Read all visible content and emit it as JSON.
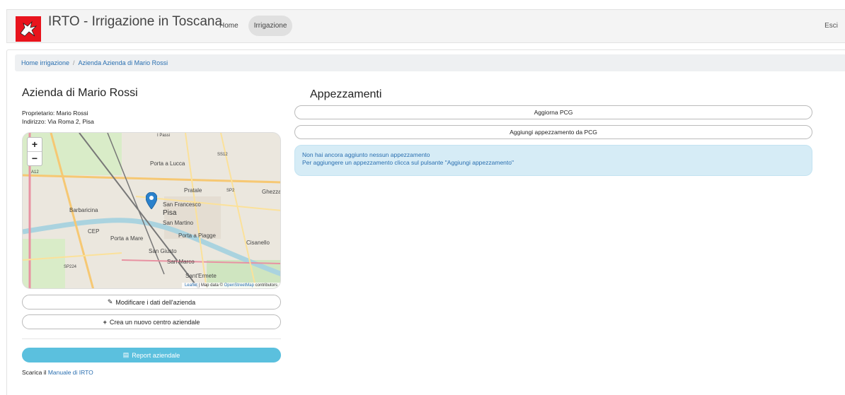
{
  "header": {
    "brand": "IRTO - Irrigazione in Toscana",
    "nav": [
      {
        "label": "Home"
      },
      {
        "label": "Irrigazione"
      }
    ],
    "logout": "Esci"
  },
  "breadcrumb": {
    "items": [
      "Home irrigazione",
      "Azienda Azienda di Mario Rossi"
    ],
    "separator": "/"
  },
  "farm": {
    "title": "Azienda di Mario Rossi",
    "owner": "Proprietario: Mario Rossi",
    "address": "Indirizzo: Via Roma 2, Pisa"
  },
  "map": {
    "zoom_in": "+",
    "zoom_out": "−",
    "attribution_leaflet": "Leaflet",
    "attribution_sep": " | Map data © ",
    "attribution_osm": "OpenStreetMap",
    "attribution_tail": " contributors",
    "places": [
      "Porta a Lucca",
      "Pratale",
      "Ghezzano",
      "Barbaricina",
      "San Francesco",
      "Pisa",
      "San Martino",
      "CEP",
      "Porta a Mare",
      "Porta a Piagge",
      "Cisanello",
      "San Giusto",
      "San Marco",
      "Sant'Ermete",
      "SP224",
      "SS12",
      "SP2",
      "A12",
      "I Passi"
    ],
    "marker_color": "#2a81cb"
  },
  "actions": {
    "edit_farm": "Modificare i dati dell'azienda",
    "new_center": "Crea un nuovo centro aziendale",
    "report": "Report aziendale"
  },
  "manual": {
    "prefix": "Scarica il ",
    "link": "Manuale di IRTO"
  },
  "plots": {
    "title": "Appezzamenti",
    "update_pcg": "Aggiorna PCG",
    "add_from_pcg": "Aggiungi appezzamento da PCG",
    "empty_line1": "Non hai ancora aggiunto nessun appezzamento",
    "empty_line2": "Per aggiungere un appezzamento clicca sul pulsante \"Aggiungi appezzamento\""
  },
  "colors": {
    "accent": "#5bc0de",
    "link": "#2a6fb0",
    "logo_red": "#e8141d",
    "info_bg": "#d6ecf6"
  }
}
